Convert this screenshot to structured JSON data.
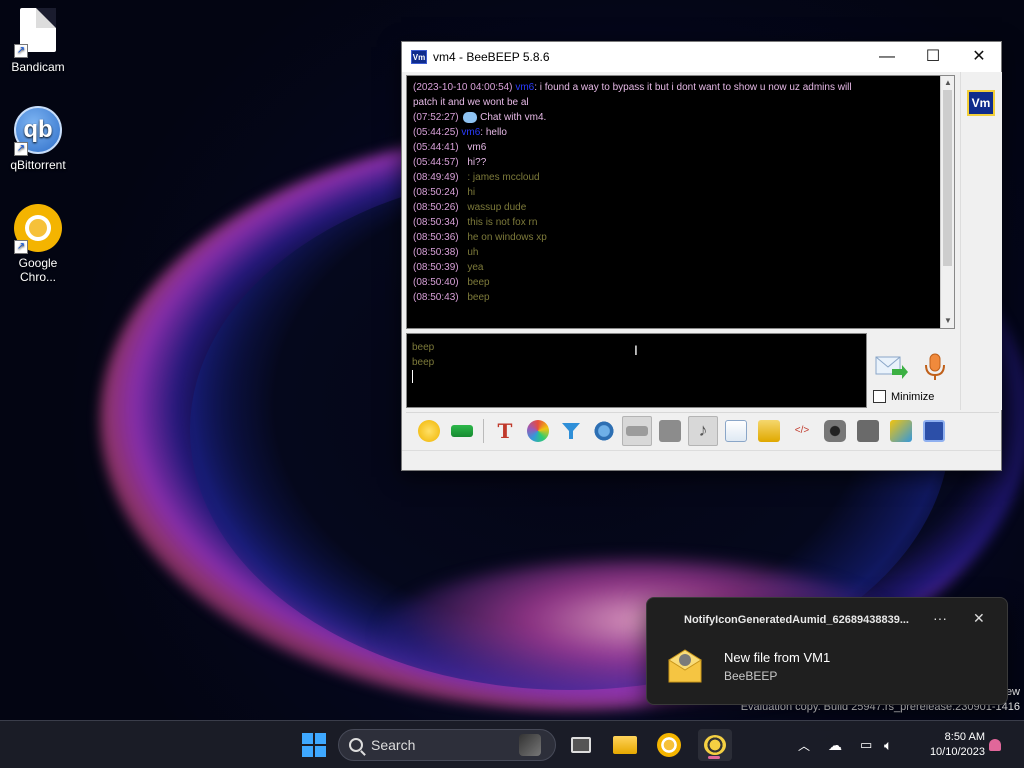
{
  "desktop": {
    "icons": [
      {
        "label": "Bandicam",
        "icon": "document-icon"
      },
      {
        "label": "qBittorrent",
        "icon": "qbittorrent-icon",
        "glyph": "qb"
      },
      {
        "label": "Google Chro...",
        "icon": "chrome-icon"
      }
    ]
  },
  "window": {
    "title": "vm4 - BeeBEEP 5.8.6",
    "app_icon_text": "Vm",
    "minimize_glyph": "—",
    "maximize_glyph": "☐",
    "close_glyph": "✕",
    "chat": [
      {
        "ts": "(2023-10-10 04:00:54)",
        "who": "vm6",
        "text": ": i found a way to bypass it but i dont want to show u now uz admins will",
        "style": "pink"
      },
      {
        "ts": "",
        "who": "",
        "text": "patch it and we wont be al",
        "style": "pink"
      },
      {
        "ts": "(07:52:27)",
        "who": "",
        "text": " Chat with vm4.",
        "style": "pink",
        "icon": "chat-bubble-icon"
      },
      {
        "ts": "(05:44:25)",
        "who": "vm6",
        "text": ": hello",
        "style": "pink"
      },
      {
        "ts": "(05:44:41)",
        "who": "",
        "text": "vm6",
        "style": "white"
      },
      {
        "ts": "(05:44:57)",
        "who": "",
        "text": "hi??",
        "style": "white"
      },
      {
        "ts": "(08:49:49)",
        "who": "",
        "text": ": james mccloud",
        "style": "olive"
      },
      {
        "ts": "(08:50:24)",
        "who": "",
        "text": "hi",
        "style": "olive"
      },
      {
        "ts": "(08:50:26)",
        "who": "",
        "text": "wassup dude",
        "style": "olive"
      },
      {
        "ts": "(08:50:34)",
        "who": "",
        "text": "this is not fox rn",
        "style": "olive"
      },
      {
        "ts": "(08:50:36)",
        "who": "",
        "text": "he on windows xp",
        "style": "olive"
      },
      {
        "ts": "(08:50:38)",
        "who": "",
        "text": "uh",
        "style": "olive"
      },
      {
        "ts": "(08:50:39)",
        "who": "",
        "text": "yea",
        "style": "olive"
      },
      {
        "ts": "(08:50:40)",
        "who": "",
        "text": "beep",
        "style": "olive"
      },
      {
        "ts": "(08:50:43)",
        "who": "",
        "text": "beep",
        "style": "olive"
      }
    ],
    "input_lines": [
      "beep",
      "beep"
    ],
    "side_badge": "Vm",
    "minimize_label": "Minimize",
    "toolbar_icons": [
      "emoticon-icon",
      "highlight-icon",
      "font-icon",
      "color-palette-icon",
      "filter-icon",
      "settings-gear-icon",
      "keyboard-icon",
      "spellcheck-icon",
      "music-note-icon",
      "export-file-icon",
      "send-file-icon",
      "html-code-icon",
      "screenshot-icon",
      "window-icon",
      "notes-icon",
      "save-icon"
    ]
  },
  "notification": {
    "header": "NotifyIconGeneratedAumid_62689438839...",
    "more": "···",
    "close": "✕",
    "title": "New file from VM1",
    "subtitle": "BeeBEEP"
  },
  "watermark": {
    "line1": "ew",
    "line2": "Evaluation copy. Build 25947.rs_prerelease.230901-1416"
  },
  "taskbar": {
    "search_label": "Search",
    "clock_time": "8:50 AM",
    "clock_date": "10/10/2023"
  },
  "colors": {
    "timestamp": "#d8a0d8",
    "user": "#2a3cff",
    "olive_text": "#7d7a3a",
    "start_blue": "#3ea8ff"
  }
}
